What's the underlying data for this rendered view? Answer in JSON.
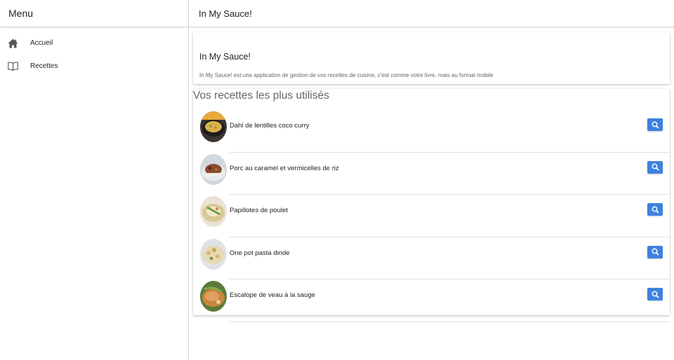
{
  "sidebar": {
    "title": "Menu",
    "items": [
      {
        "label": "Accueil",
        "icon": "home-icon"
      },
      {
        "label": "Recettes",
        "icon": "book-icon"
      }
    ]
  },
  "header": {
    "title": "In My Sauce!"
  },
  "intro": {
    "title": "In My Sauce!",
    "description": "In My Sauce! est une application de gestion de vos recettes de cuisine, c'est comme votre livre, mais au format mobile"
  },
  "recipes": {
    "title": "Vos recettes les plus utilisés",
    "items": [
      {
        "name": "Dahl de lentilles coco curry",
        "action_icon": "search-icon"
      },
      {
        "name": "Porc au caramel et vermicelles de riz",
        "action_icon": "search-icon"
      },
      {
        "name": "Papillotes de poulet",
        "action_icon": "search-icon"
      },
      {
        "name": "One pot pasta dinde",
        "action_icon": "search-icon"
      },
      {
        "name": "Escalope de veau à la sauge",
        "action_icon": "search-icon"
      }
    ]
  },
  "colors": {
    "accent": "#3e82e0",
    "border": "#d8d8d8"
  }
}
